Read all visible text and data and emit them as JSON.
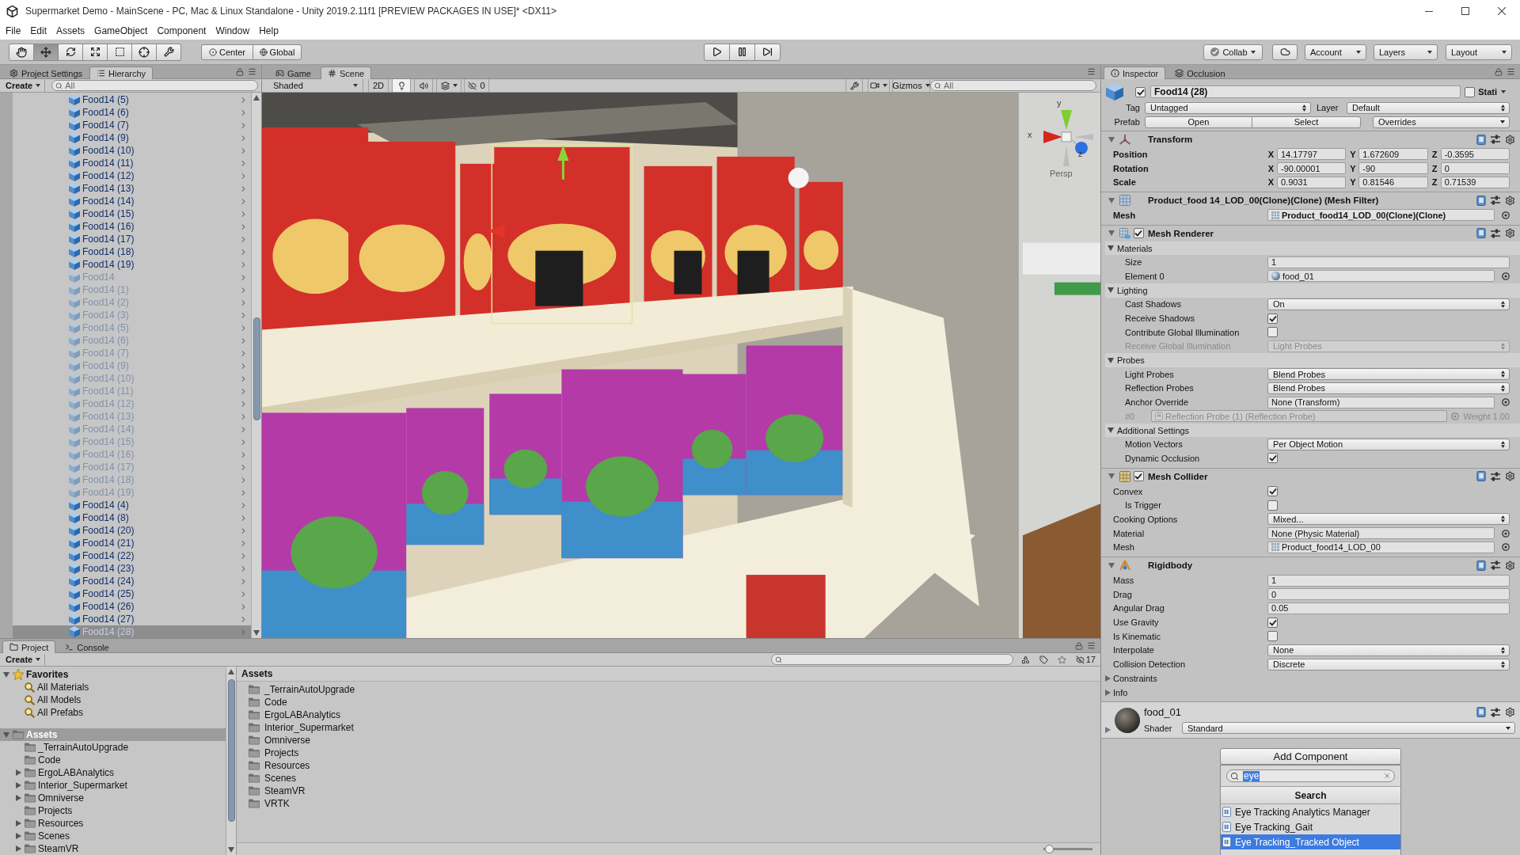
{
  "window": {
    "title": "Supermarket Demo - MainScene - PC, Mac & Linux Standalone - Unity 2019.2.11f1 [PREVIEW PACKAGES IN USE]* <DX11>"
  },
  "menu": [
    "File",
    "Edit",
    "Assets",
    "GameObject",
    "Component",
    "Window",
    "Help"
  ],
  "toolbar": {
    "tools": [
      {
        "kind": "hand",
        "selected": false
      },
      {
        "kind": "move",
        "selected": true
      },
      {
        "kind": "rotate",
        "selected": false
      },
      {
        "kind": "scale",
        "selected": false
      },
      {
        "kind": "rect",
        "selected": false
      },
      {
        "kind": "transform",
        "selected": false
      },
      {
        "kind": "custom",
        "selected": false
      }
    ],
    "pivot": [
      {
        "kind": "center",
        "label": "Center"
      },
      {
        "kind": "global",
        "label": "Global"
      }
    ],
    "playback": [
      {
        "kind": "play"
      },
      {
        "kind": "pause"
      },
      {
        "kind": "step"
      }
    ],
    "collab": "Collab",
    "account": "Account",
    "layers": "Layers",
    "layout": "Layout"
  },
  "hierarchy": {
    "tabs": [
      {
        "kind": "settings",
        "label": "Project Settings",
        "selected": false
      },
      {
        "kind": "list",
        "label": "Hierarchy",
        "selected": true
      }
    ],
    "create": "Create",
    "search": {
      "placeholder": "All"
    },
    "items": [
      {
        "label": "Food14 (5)",
        "active": true,
        "selected": false
      },
      {
        "label": "Food14 (6)",
        "active": true,
        "selected": false
      },
      {
        "label": "Food14 (7)",
        "active": true,
        "selected": false
      },
      {
        "label": "Food14 (9)",
        "active": true,
        "selected": false
      },
      {
        "label": "Food14 (10)",
        "active": true,
        "selected": false
      },
      {
        "label": "Food14 (11)",
        "active": true,
        "selected": false
      },
      {
        "label": "Food14 (12)",
        "active": true,
        "selected": false
      },
      {
        "label": "Food14 (13)",
        "active": true,
        "selected": false
      },
      {
        "label": "Food14 (14)",
        "active": true,
        "selected": false
      },
      {
        "label": "Food14 (15)",
        "active": true,
        "selected": false
      },
      {
        "label": "Food14 (16)",
        "active": true,
        "selected": false
      },
      {
        "label": "Food14 (17)",
        "active": true,
        "selected": false
      },
      {
        "label": "Food14 (18)",
        "active": true,
        "selected": false
      },
      {
        "label": "Food14 (19)",
        "active": true,
        "selected": false
      },
      {
        "label": "Food14",
        "active": false,
        "selected": false
      },
      {
        "label": "Food14 (1)",
        "active": false,
        "selected": false
      },
      {
        "label": "Food14 (2)",
        "active": false,
        "selected": false
      },
      {
        "label": "Food14 (3)",
        "active": false,
        "selected": false
      },
      {
        "label": "Food14 (5)",
        "active": false,
        "selected": false
      },
      {
        "label": "Food14 (6)",
        "active": false,
        "selected": false
      },
      {
        "label": "Food14 (7)",
        "active": false,
        "selected": false
      },
      {
        "label": "Food14 (9)",
        "active": false,
        "selected": false
      },
      {
        "label": "Food14 (10)",
        "active": false,
        "selected": false
      },
      {
        "label": "Food14 (11)",
        "active": false,
        "selected": false
      },
      {
        "label": "Food14 (12)",
        "active": false,
        "selected": false
      },
      {
        "label": "Food14 (13)",
        "active": false,
        "selected": false
      },
      {
        "label": "Food14 (14)",
        "active": false,
        "selected": false
      },
      {
        "label": "Food14 (15)",
        "active": false,
        "selected": false
      },
      {
        "label": "Food14 (16)",
        "active": false,
        "selected": false
      },
      {
        "label": "Food14 (17)",
        "active": false,
        "selected": false
      },
      {
        "label": "Food14 (18)",
        "active": false,
        "selected": false
      },
      {
        "label": "Food14 (19)",
        "active": false,
        "selected": false
      },
      {
        "label": "Food14 (4)",
        "active": true,
        "selected": false
      },
      {
        "label": "Food14 (8)",
        "active": true,
        "selected": false
      },
      {
        "label": "Food14 (20)",
        "active": true,
        "selected": false
      },
      {
        "label": "Food14 (21)",
        "active": true,
        "selected": false
      },
      {
        "label": "Food14 (22)",
        "active": true,
        "selected": false
      },
      {
        "label": "Food14 (23)",
        "active": true,
        "selected": false
      },
      {
        "label": "Food14 (24)",
        "active": true,
        "selected": false
      },
      {
        "label": "Food14 (25)",
        "active": true,
        "selected": false
      },
      {
        "label": "Food14 (26)",
        "active": true,
        "selected": false
      },
      {
        "label": "Food14 (27)",
        "active": true,
        "selected": false
      },
      {
        "label": "Food14 (28)",
        "active": true,
        "selected": true
      }
    ]
  },
  "scene": {
    "tabs": [
      {
        "kind": "game",
        "label": "Game",
        "selected": false
      },
      {
        "kind": "scene",
        "label": "Scene",
        "selected": true
      }
    ],
    "shading": "Shaded",
    "mode_2d": {
      "label": "2D",
      "on": false
    },
    "toggles": [
      {
        "kind": "lighting",
        "on": true
      },
      {
        "kind": "audio",
        "on": false
      },
      {
        "kind": "effects",
        "on": false
      }
    ],
    "hidden": "0",
    "gizmos": "Gizmos",
    "search": {
      "placeholder": "All"
    },
    "orientation": {
      "axes": [
        "y",
        "x",
        "z"
      ],
      "projection": "Persp"
    }
  },
  "inspector": {
    "tabs": [
      {
        "kind": "info",
        "label": "Inspector",
        "selected": true
      },
      {
        "kind": "occlusion",
        "label": "Occlusion",
        "selected": false
      }
    ],
    "object": {
      "active": true,
      "name": "Food14 (28)",
      "static": {
        "label": "Stati",
        "checked": false
      },
      "tag": {
        "label": "Tag",
        "value": "Untagged"
      },
      "layer": {
        "label": "Layer",
        "value": "Default"
      },
      "prefab": {
        "label": "Prefab",
        "buttons": [
          "Open",
          "Select"
        ],
        "overrides": "Overrides"
      }
    },
    "components": [
      {
        "kind": "transform",
        "title": "Transform",
        "expanded": true,
        "rows": [
          {
            "kind": "vector",
            "label": "Position",
            "overridden": true,
            "values": [
              {
                "axis": "X",
                "value": "14.17797"
              },
              {
                "axis": "Y",
                "value": "1.672609"
              },
              {
                "axis": "Z",
                "value": "-0.3595"
              }
            ]
          },
          {
            "kind": "vector",
            "label": "Rotation",
            "overridden": true,
            "values": [
              {
                "axis": "X",
                "value": "-90.00001"
              },
              {
                "axis": "Y",
                "value": "-90"
              },
              {
                "axis": "Z",
                "value": "0"
              }
            ]
          },
          {
            "kind": "vector",
            "label": "Scale",
            "overridden": true,
            "values": [
              {
                "axis": "X",
                "value": "0.9031"
              },
              {
                "axis": "Y",
                "value": "0.81546"
              },
              {
                "axis": "Z",
                "value": "0.71539"
              }
            ]
          }
        ]
      },
      {
        "kind": "mesh_filter",
        "title": "Product_food 14_LOD_00(Clone)(Clone) (Mesh Filter)",
        "expanded": true,
        "rows": [
          {
            "kind": "mesh_object",
            "label": "Mesh",
            "overridden": true,
            "value": "Product_food14_LOD_00(Clone)(Clone)"
          }
        ]
      },
      {
        "kind": "mesh_renderer",
        "title": "Mesh Renderer",
        "expanded": true,
        "enabled": true,
        "rows": [
          {
            "kind": "section",
            "label": "Materials",
            "expanded": true,
            "children": [
              {
                "kind": "text",
                "label": "Size",
                "value": "1"
              },
              {
                "kind": "material_object",
                "label": "Element 0",
                "value": "food_01"
              }
            ]
          },
          {
            "kind": "section",
            "label": "Lighting",
            "expanded": true,
            "children": [
              {
                "kind": "dropdown",
                "label": "Cast Shadows",
                "value": "On",
                "disabled": false
              },
              {
                "kind": "checkbox",
                "label": "Receive Shadows",
                "checked": true,
                "disabled": false
              },
              {
                "kind": "checkbox",
                "label": "Contribute Global Illumination",
                "checked": false,
                "disabled": false
              },
              {
                "kind": "dropdown",
                "label": "Receive Global Illumination",
                "value": "Light Probes",
                "disabled": true
              }
            ]
          },
          {
            "kind": "section",
            "label": "Probes",
            "expanded": true,
            "children": [
              {
                "kind": "dropdown",
                "label": "Light Probes",
                "value": "Blend Probes",
                "disabled": false
              },
              {
                "kind": "dropdown",
                "label": "Reflection Probes",
                "value": "Blend Probes",
                "disabled": false
              },
              {
                "kind": "object",
                "label": "Anchor Override",
                "value": "None (Transform)",
                "disabled": false
              },
              {
                "kind": "probe",
                "label": "#0",
                "value": "Reflection Probe (1) (Reflection Probe)",
                "weight": "Weight 1.00",
                "disabled": true
              }
            ]
          },
          {
            "kind": "section",
            "label": "Additional Settings",
            "expanded": true,
            "children": [
              {
                "kind": "dropdown",
                "label": "Motion Vectors",
                "value": "Per Object Motion"
              },
              {
                "kind": "checkbox",
                "label": "Dynamic Occlusion",
                "checked": true
              }
            ]
          }
        ]
      },
      {
        "kind": "mesh_collider",
        "title": "Mesh Collider",
        "expanded": true,
        "enabled": true,
        "rows": [
          {
            "kind": "checkbox",
            "label": "Convex",
            "checked": true,
            "children": [
              {
                "kind": "checkbox",
                "label": "Is Trigger",
                "checked": false
              }
            ]
          },
          {
            "kind": "dropdown",
            "label": "Cooking Options",
            "value": "Mixed..."
          },
          {
            "kind": "object",
            "label": "Material",
            "value": "None (Physic Material)"
          },
          {
            "kind": "mesh_object",
            "label": "Mesh",
            "value": "Product_food14_LOD_00"
          }
        ]
      },
      {
        "kind": "rigidbody",
        "title": "Rigidbody",
        "expanded": true,
        "rows": [
          {
            "kind": "text",
            "label": "Mass",
            "value": "1"
          },
          {
            "kind": "text",
            "label": "Drag",
            "value": "0"
          },
          {
            "kind": "text",
            "label": "Angular Drag",
            "value": "0.05"
          },
          {
            "kind": "checkbox",
            "label": "Use Gravity",
            "checked": true
          },
          {
            "kind": "checkbox",
            "label": "Is Kinematic",
            "checked": false
          },
          {
            "kind": "dropdown",
            "label": "Interpolate",
            "value": "None"
          },
          {
            "kind": "dropdown",
            "label": "Collision Detection",
            "value": "Discrete"
          },
          {
            "kind": "foldout",
            "label": "Constraints",
            "expanded": false
          },
          {
            "kind": "foldout",
            "label": "Info",
            "expanded": false
          }
        ]
      },
      {
        "kind": "material",
        "title": "food_01",
        "expanded": false,
        "shader": {
          "label": "Shader",
          "value": "Standard"
        }
      }
    ],
    "add_component": {
      "label": "Add Component",
      "search": {
        "value": "eye",
        "text_selected": true
      },
      "header": "Search",
      "items": [
        {
          "label": "Eye Tracking Analytics Manager",
          "selected": false
        },
        {
          "label": "Eye Tracking_Gait",
          "selected": false
        },
        {
          "label": "Eye Tracking_Tracked Object",
          "selected": true
        }
      ]
    }
  },
  "project": {
    "tabs": [
      {
        "kind": "folder",
        "label": "Project",
        "selected": true
      },
      {
        "kind": "console",
        "label": "Console",
        "selected": false
      }
    ],
    "create": "Create",
    "hidden": "17",
    "tree": [
      {
        "kind": "favorites",
        "label": "Favorites",
        "expanded": true,
        "selected": false,
        "children": [
          {
            "kind": "search",
            "label": "All Materials",
            "expandable": false,
            "selected": false
          },
          {
            "kind": "search",
            "label": "All Models",
            "expandable": false,
            "selected": false
          },
          {
            "kind": "search",
            "label": "All Prefabs",
            "expandable": false,
            "selected": false
          }
        ]
      },
      {
        "kind": "folder",
        "label": "Assets",
        "expanded": true,
        "selected": true,
        "children": [
          {
            "kind": "folder",
            "label": "_TerrainAutoUpgrade",
            "expandable": false,
            "selected": false
          },
          {
            "kind": "folder",
            "label": "Code",
            "expandable": false,
            "selected": false
          },
          {
            "kind": "folder",
            "label": "ErgoLABAnalytics",
            "expandable": true,
            "selected": false
          },
          {
            "kind": "folder",
            "label": "Interior_Supermarket",
            "expandable": true,
            "selected": false
          },
          {
            "kind": "folder",
            "label": "Omniverse",
            "expandable": true,
            "selected": false
          },
          {
            "kind": "folder",
            "label": "Projects",
            "expandable": false,
            "selected": false
          },
          {
            "kind": "folder",
            "label": "Resources",
            "expandable": true,
            "selected": false
          },
          {
            "kind": "folder",
            "label": "Scenes",
            "expandable": true,
            "selected": false
          },
          {
            "kind": "folder",
            "label": "SteamVR",
            "expandable": true,
            "selected": false
          }
        ]
      }
    ],
    "assets": {
      "title": "Assets",
      "items": [
        {
          "label": "_TerrainAutoUpgrade",
          "selected": false
        },
        {
          "label": "Code",
          "selected": false
        },
        {
          "label": "ErgoLABAnalytics",
          "selected": false
        },
        {
          "label": "Interior_Supermarket",
          "selected": false
        },
        {
          "label": "Omniverse",
          "selected": false
        },
        {
          "label": "Projects",
          "selected": false
        },
        {
          "label": "Resources",
          "selected": false
        },
        {
          "label": "Scenes",
          "selected": false
        },
        {
          "label": "SteamVR",
          "selected": false
        },
        {
          "label": "VRTK",
          "selected": false
        }
      ]
    },
    "zoom_slider": {
      "level": 0.04
    }
  }
}
